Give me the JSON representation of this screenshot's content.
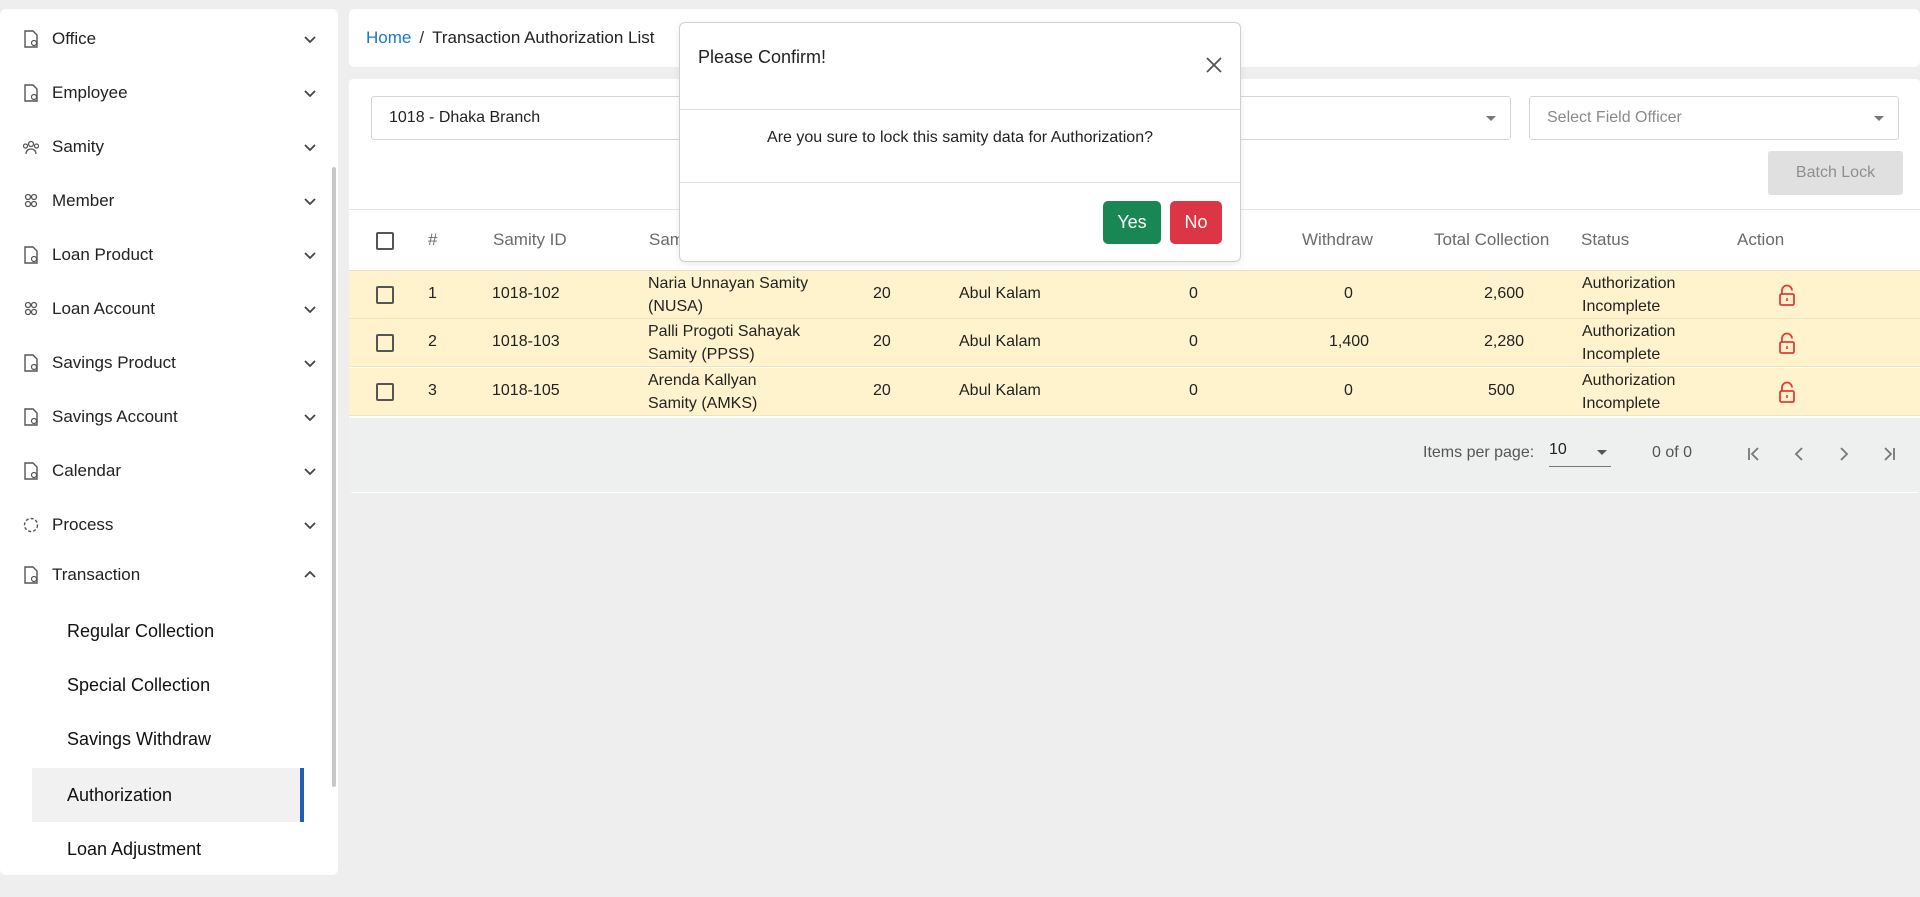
{
  "sidebar": {
    "items": [
      {
        "label": "Office",
        "icon": "document-gear-icon",
        "expanded": false
      },
      {
        "label": "Employee",
        "icon": "document-gear-icon",
        "expanded": false
      },
      {
        "label": "Samity",
        "icon": "group-icon",
        "expanded": false
      },
      {
        "label": "Member",
        "icon": "people-icon",
        "expanded": false
      },
      {
        "label": "Loan Product",
        "icon": "document-gear-icon",
        "expanded": false
      },
      {
        "label": "Loan Account",
        "icon": "people-icon",
        "expanded": false
      },
      {
        "label": "Savings Product",
        "icon": "document-gear-icon",
        "expanded": false
      },
      {
        "label": "Savings Account",
        "icon": "document-gear-icon",
        "expanded": false
      },
      {
        "label": "Calendar",
        "icon": "document-gear-icon",
        "expanded": false
      },
      {
        "label": "Process",
        "icon": "process-icon",
        "expanded": false
      },
      {
        "label": "Transaction",
        "icon": "document-gear-icon",
        "expanded": true
      }
    ],
    "subitems": [
      {
        "label": "Regular Collection"
      },
      {
        "label": "Special Collection"
      },
      {
        "label": "Savings Withdraw"
      },
      {
        "label": "Authorization",
        "active": true
      },
      {
        "label": "Loan Adjustment"
      }
    ]
  },
  "breadcrumb": {
    "home": "Home",
    "separator": "/",
    "current": "Transaction Authorization List"
  },
  "filters": {
    "branch": "1018 - Dhaka Branch",
    "field_officer_placeholder": "Select Field Officer",
    "batch_lock": "Batch Lock"
  },
  "table": {
    "headers": {
      "num": "#",
      "samity_id": "Samity ID",
      "samity_name": "Sam",
      "withdraw": "Withdraw",
      "total_collection": "Total Collection",
      "status": "Status",
      "action": "Action"
    },
    "rows": [
      {
        "num": "1",
        "samity_id": "1018-102",
        "name_line1": "Naria Unnayan Samity",
        "name_line2": "(NUSA)",
        "col5": "20",
        "officer": "Abul Kalam",
        "col7": "0",
        "withdraw": "0",
        "total": "2,600",
        "status_line1": "Authorization",
        "status_line2": "Incomplete"
      },
      {
        "num": "2",
        "samity_id": "1018-103",
        "name_line1": "Palli Progoti Sahayak",
        "name_line2": "Samity (PPSS)",
        "col5": "20",
        "officer": "Abul Kalam",
        "col7": "0",
        "withdraw": "1,400",
        "total": "2,280",
        "status_line1": "Authorization",
        "status_line2": "Incomplete"
      },
      {
        "num": "3",
        "samity_id": "1018-105",
        "name_line1": "Arenda Kallyan",
        "name_line2": "Samity (AMKS)",
        "col5": "20",
        "officer": "Abul Kalam",
        "col7": "0",
        "withdraw": "0",
        "total": "500",
        "status_line1": "Authorization",
        "status_line2": "Incomplete"
      }
    ]
  },
  "paginator": {
    "label": "Items per page:",
    "page_size": "10",
    "range": "0 of 0"
  },
  "modal": {
    "title": "Please Confirm!",
    "message": "Are you sure to lock this samity data for Authorization?",
    "yes": "Yes",
    "no": "No"
  },
  "colors": {
    "row_highlight": "#fff3cd",
    "yes": "#198754",
    "no": "#dc3545",
    "lock": "#e53935",
    "link": "#1976d2",
    "active_indicator": "#1e5fb3"
  }
}
